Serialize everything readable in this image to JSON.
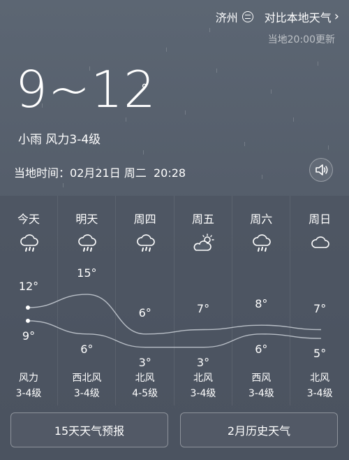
{
  "header": {
    "city": "济州",
    "compare_label": "对比本地天气",
    "update_text": "当地20:00更新"
  },
  "current": {
    "temp_range": "9~12",
    "degree": "°",
    "condition": "小雨 风力3-4级",
    "local_time_label": "当地时间：",
    "local_time_value": "02月21日 周二  20:28"
  },
  "forecast": [
    {
      "day": "今天",
      "icon": "rain-cloud-icon",
      "high": "12°",
      "low": "9°",
      "wind_dir": "风力",
      "wind_level": "3-4级"
    },
    {
      "day": "明天",
      "icon": "rain-cloud-icon",
      "high": "15°",
      "low": "6°",
      "wind_dir": "西北风",
      "wind_level": "3-4级"
    },
    {
      "day": "周四",
      "icon": "rain-cloud-icon",
      "high": "6°",
      "low": "3°",
      "wind_dir": "北风",
      "wind_level": "4-5级"
    },
    {
      "day": "周五",
      "icon": "partly-cloudy-icon",
      "high": "7°",
      "low": "3°",
      "wind_dir": "北风",
      "wind_level": "3-4级"
    },
    {
      "day": "周六",
      "icon": "rain-cloud-icon",
      "high": "8°",
      "low": "6°",
      "wind_dir": "西风",
      "wind_level": "3-4级"
    },
    {
      "day": "周日",
      "icon": "cloud-icon",
      "high": "7°",
      "low": "5°",
      "wind_dir": "北风",
      "wind_level": "3-4级"
    }
  ],
  "chart_data": {
    "type": "line",
    "categories": [
      "今天",
      "明天",
      "周四",
      "周五",
      "周六",
      "周日"
    ],
    "series": [
      {
        "values": [
          12,
          15,
          6,
          7,
          8,
          7
        ]
      },
      {
        "values": [
          9,
          6,
          3,
          3,
          6,
          5
        ]
      }
    ]
  },
  "buttons": {
    "forecast_15": "15天天气预报",
    "history": "2月历史天气"
  }
}
